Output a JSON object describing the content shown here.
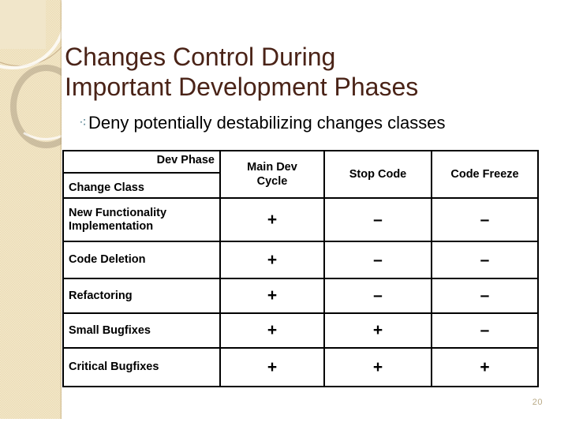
{
  "slide": {
    "title": "Changes Control During Important Development Phases",
    "title_line1": "Changes Control During",
    "title_line2": "Important Development Phases",
    "title_color": "#4a2317",
    "page_number": "20",
    "background_color": "#ffffff",
    "sidebar_color": "#ecdcb4"
  },
  "bullet": {
    "glyph": "⎪\u0000",
    "marker": "ડ\u0000",
    "icon_char": "۞",
    "text": "Deny potentially destabilizing changes classes"
  },
  "table": {
    "corner": {
      "column_axis_label": "Dev Phase",
      "row_axis_label": "Change Class"
    },
    "columns": [
      "Main Dev Cycle",
      "Stop Code",
      "Code Freeze"
    ],
    "columns_detail": [
      {
        "label": "Main Dev Cycle",
        "line1": "Main Dev",
        "line2": "Cycle"
      },
      {
        "label": "Stop Code",
        "line1": "Stop Code",
        "line2": ""
      },
      {
        "label": "Code Freeze",
        "line1": "Code Freeze",
        "line2": ""
      }
    ],
    "rows": [
      {
        "label": "New Functionality Implementation",
        "label_line1": "New Functionality",
        "label_line2": "Implementation",
        "values": [
          "+",
          "–",
          "–"
        ]
      },
      {
        "label": "Code Deletion",
        "label_line1": "Code Deletion",
        "label_line2": "",
        "values": [
          "+",
          "–",
          "–"
        ]
      },
      {
        "label": "Refactoring",
        "label_line1": "Refactoring",
        "label_line2": "",
        "values": [
          "+",
          "–",
          "–"
        ]
      },
      {
        "label": "Small Bugfixes",
        "label_line1": "Small Bugfixes",
        "label_line2": "",
        "values": [
          "+",
          "+",
          "–"
        ]
      },
      {
        "label": "Critical Bugfixes",
        "label_line1": "Critical Bugfixes",
        "label_line2": "",
        "values": [
          "+",
          "+",
          "+"
        ]
      }
    ]
  }
}
